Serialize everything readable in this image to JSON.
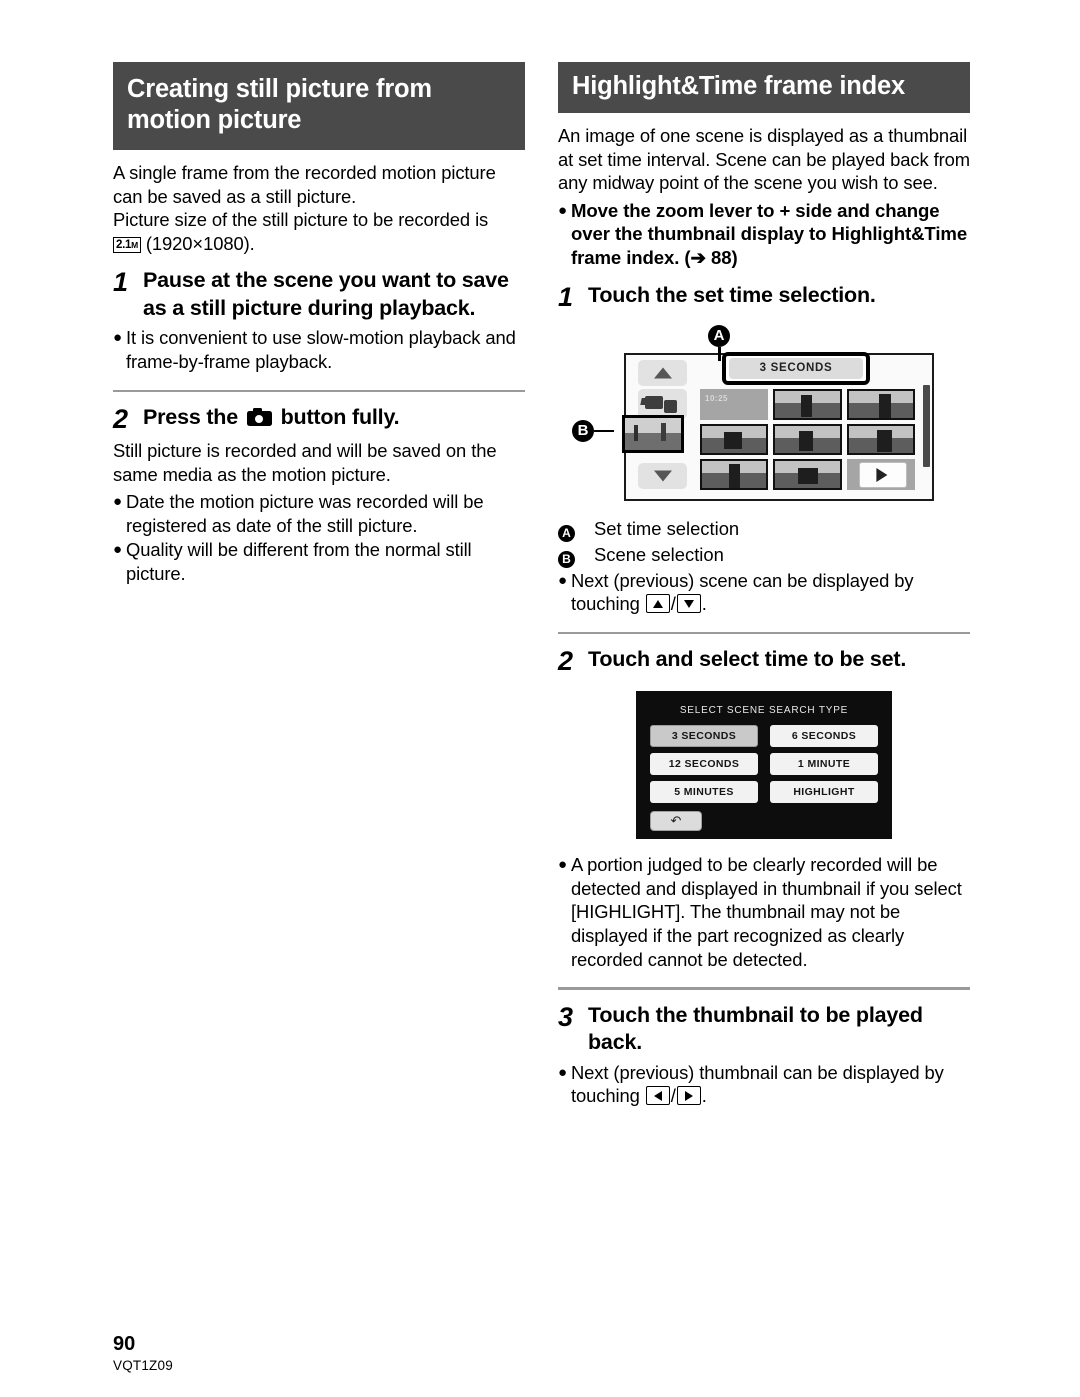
{
  "left": {
    "header": "Creating still picture from motion picture",
    "intro1": "A single frame from the recorded motion picture can be saved as a still picture.",
    "intro2_pre": "Picture size of the still picture to be recorded is",
    "size_icon": "2.1",
    "size_icon_unit": "M",
    "intro2_post": "(1920×1080).",
    "step1_num": "1",
    "step1_title": "Pause at the scene you want to save as a still picture during playback.",
    "step1_bullet1": "It is convenient to use slow-motion playback and frame-by-frame playback.",
    "step2_num": "2",
    "step2_title_pre": "Press the",
    "step2_title_post": "button fully.",
    "step2_text": "Still picture is recorded and will be saved on the same media as the motion picture.",
    "step2_bullet1": "Date the motion picture was recorded will be registered as date of the still picture.",
    "step2_bullet2": "Quality will be different from the normal still picture."
  },
  "right": {
    "header": "Highlight&Time frame index",
    "intro": "An image of one scene is displayed as a thumbnail at set time interval. Scene can be played back from any midway point of the scene you wish to see.",
    "intro_bullet": "Move the zoom lever to + side and change over the thumbnail display to Highlight&Time frame index. (➔ 88)",
    "step1_num": "1",
    "step1_title": "Touch the set time selection.",
    "legend_a_mark": "A",
    "legend_a": "Set time selection",
    "legend_b_mark": "B",
    "legend_b": "Scene selection",
    "legend_bullet_pre": "Next (previous) scene can be displayed by touching",
    "legend_bullet_post": ".",
    "step2_num": "2",
    "step2_title": "Touch and select time to be set.",
    "step2_bullet": "A portion judged to be clearly recorded will be detected and displayed in thumbnail if you select [HIGHLIGHT]. The thumbnail may not be displayed if the part recognized as clearly recorded cannot be detected.",
    "step3_num": "3",
    "step3_title": "Touch the thumbnail to be played back.",
    "step3_bullet_pre": "Next (previous) thumbnail can be displayed by touching",
    "step3_bullet_post": "."
  },
  "figure1": {
    "time_button_label": "3 SECONDS",
    "marker_a": "A",
    "marker_b": "B",
    "thumb_date": "10:25"
  },
  "figure2": {
    "title": "SELECT SCENE SEARCH TYPE",
    "options": [
      "3 SECONDS",
      "6 SECONDS",
      "12 SECONDS",
      "1 MINUTE",
      "5 MINUTES",
      "HIGHLIGHT"
    ],
    "selected": "3 SECONDS",
    "back_label": "↶"
  },
  "footer": {
    "page_number": "90",
    "doc_code": "VQT1Z09"
  },
  "colors": {
    "header_bg": "#4a4a4a",
    "rule": "#9a9a9a",
    "screen_bg": "#0d0d0d"
  }
}
